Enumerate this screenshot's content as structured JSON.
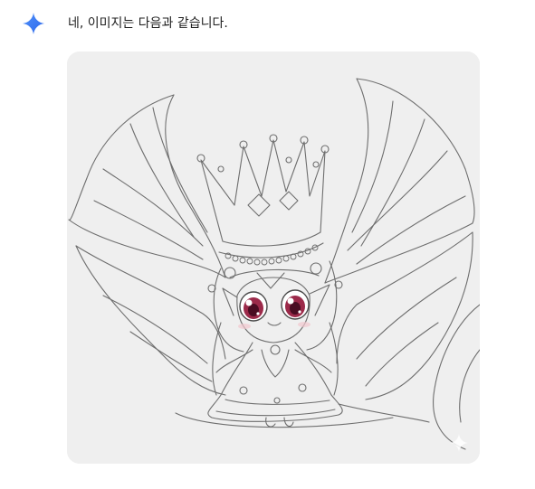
{
  "message": {
    "text": "네, 이미지는 다음과 같습니다."
  },
  "assistant_icon": {
    "name": "gemini-sparkle-icon",
    "color_top": "#4285f4",
    "color_bottom": "#1a73e8"
  },
  "generated_image": {
    "description_icon": "fairy-princess-line-drawing",
    "background_color": "#efefef",
    "watermark_icon": "sparkle-watermark-icon"
  }
}
